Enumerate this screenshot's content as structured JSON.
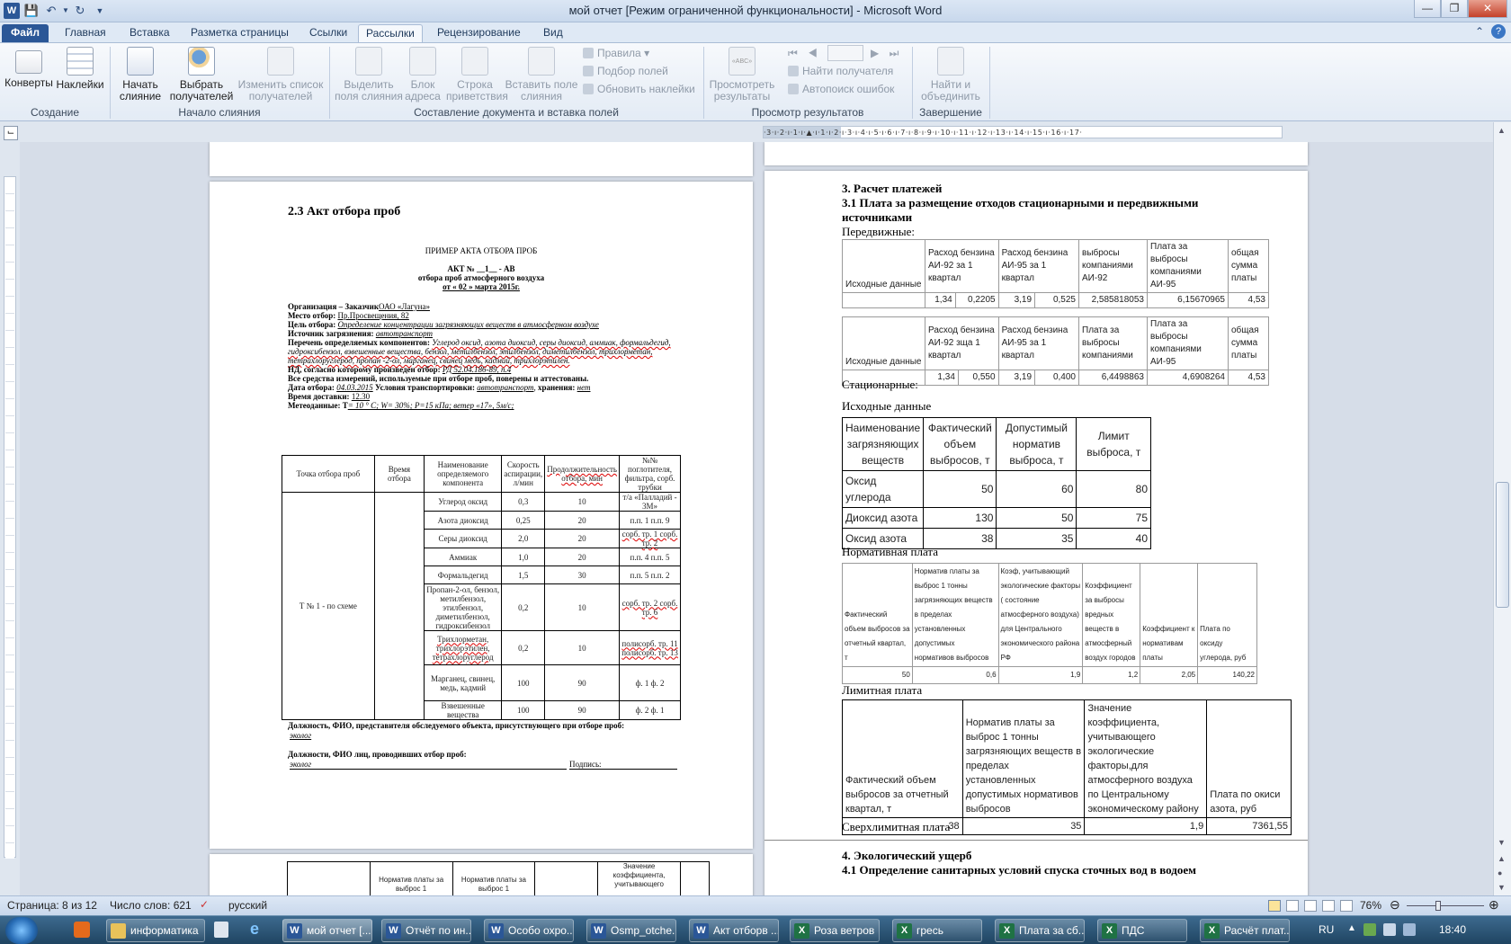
{
  "window": {
    "title": "мой отчет [Режим ограниченной функциональности]  -  Microsoft Word"
  },
  "menu": {
    "file": "Файл",
    "tabs": [
      "Главная",
      "Вставка",
      "Разметка страницы",
      "Ссылки",
      "Рассылки",
      "Рецензирование",
      "Вид"
    ]
  },
  "ribbon": {
    "create": {
      "envelopes": "Конверты",
      "labels": "Наклейки",
      "group": "Создание"
    },
    "start": {
      "start_merge": "Начать слияние",
      "select_recipients": "Выбрать получателей",
      "edit_list": "Изменить список получателей",
      "group": "Начало слияния"
    },
    "write": {
      "highlight": "Выделить поля слияния",
      "address": "Блок адреса",
      "greeting": "Строка приветствия",
      "insert_field": "Вставить поле слияния",
      "rules": "Правила",
      "match": "Подбор полей",
      "update": "Обновить наклейки",
      "group": "Составление документа и вставка полей"
    },
    "preview": {
      "view_results": "Просмотреть результаты",
      "find": "Найти получателя",
      "check": "Автопоиск ошибок",
      "group": "Просмотр результатов"
    },
    "finish": {
      "finish_merge": "Найти и объединить",
      "group": "Завершение"
    }
  },
  "page1": {
    "heading": "2.3 Акт отбора проб",
    "example": "ПРИМЕР АКТА ОТБОРА ПРОБ",
    "act_no": "АКТ № __1__ - АВ",
    "act_sub": "отбора проб атмосферного воздуха",
    "act_date": "от « 02 »  марта  2015г.",
    "fields": [
      {
        "label": "Организация – Заказчик",
        "value": "ОАО «Лагуна»"
      },
      {
        "label": "Место отбор:",
        "value": "Пр.Просвещения, 82"
      },
      {
        "label": "Цель отбора:",
        "value": "Определение концентрации загрязняющих веществ в атмосферном воздухе"
      },
      {
        "label": "Источник загрязнения:",
        "value": "автотранспорт"
      },
      {
        "label": "Перечень определяемых компонентов:",
        "value": "Углерод оксид, азота диоксид, серы диоксид, аммиак, формальдегид, гидроксибензол, взвешенные вещества, бензол, метилбензол, этилбензол, диметилбензол, трихлорметан, тетрахлоруглерод, пропан -2-ол, марганец, свинец медь, кадмий, трихлорэтилен."
      },
      {
        "label": "НД, согласно которому произведен отбор:",
        "value": "РД 52.04.186-89, п.4"
      },
      {
        "label": "Все средства измерений, используемые при отборе проб, поверены и аттестованы.",
        "value": ""
      },
      {
        "label": "Дата отбора:",
        "value": "04.03.2015"
      },
      {
        "label": "Условия транспортировки:",
        "value": "автотранспорт"
      },
      {
        "label": "хранения:",
        "value": "нет"
      },
      {
        "label": "Время доставки:",
        "value": "12.30"
      },
      {
        "label": "Метеоданные: T",
        "value": "= 10 ° С;  W= 30%;  P=15 кПа;  ветер «17»,   5м/с;"
      }
    ],
    "table_headers": [
      "Точка отбора проб",
      "Время отбора",
      "Наименование определяемого компонента",
      "Скорость аспирации, л/мин",
      "Продолжительность отбора, мин",
      "№№ поглотителя, фильтра, сорб. трубки"
    ],
    "point": "Т № 1 - по схеме",
    "rows": [
      [
        "Углерод оксид",
        "0,3",
        "10",
        "т/а «Палладий - 3М»"
      ],
      [
        "Азота диоксид",
        "0,25",
        "20",
        "п.п. 1 п.п. 9"
      ],
      [
        "Серы диоксид",
        "2,0",
        "20",
        "сорб. тр. 1 сорб. тр. 2"
      ],
      [
        "Аммиак",
        "1,0",
        "20",
        "п.п. 4 п.п. 5"
      ],
      [
        "Формальдегид",
        "1,5",
        "30",
        "п.п. 5 п.п. 2"
      ],
      [
        "Пропан-2-ол, бензол, метилбензол, этилбензол, диметилбензол, гидроксибензол",
        "0,2",
        "10",
        "сорб. тр. 2 сорб. тр. 6"
      ],
      [
        "Трихлорметан, трихлорэтилен, тетрахлоруглерод",
        "0,2",
        "10",
        "полисорб. тр. 11 полисорб. тр. 13"
      ],
      [
        "Марганец, свинец, медь, кадмий",
        "100",
        "90",
        "ф. 1 ф. 2"
      ],
      [
        "Взвешенные вещества",
        "100",
        "90",
        "ф. 2 ф. 1"
      ]
    ],
    "sign1": "Должность, ФИО, представителя обследуемого объекта, присутствующего  при отборе проб:",
    "sign1_val": "эколог",
    "sign2": "Должности, ФИО лиц, проводивших отбор проб:",
    "sign2_val": "эколог",
    "sign2_label": "Подпись:",
    "next_headers": [
      "Норматив платы за выброс 1",
      "Норматив платы за выброс 1",
      "Значение коэффициента, учитывающего"
    ]
  },
  "page2": {
    "h1": "3. Расчет платежей",
    "h2": "3.1 Плата за размещение отходов стационарными и передвижными источниками",
    "mobile": "Передвижные:",
    "t1_headers": [
      "Исходные данные",
      "Расход бензина АИ-92 за 1 квартал",
      "Расход бензина АИ-95 за 1 квартал",
      "выбросы компаниями АИ-92",
      "Плата за выбросы компаниями АИ-95",
      "общая сумма платы"
    ],
    "t1_row": [
      "1,34",
      "0,2205",
      "3,19",
      "0,525",
      "2,585818053",
      "6,15670965",
      "4,53"
    ],
    "t2_headers": [
      "Исходные данные",
      "Расход бензина АИ-92 зща 1 квартал",
      "Расход бензина АИ-95 за 1 квартал",
      "Плата за выбросы компаниями",
      "Плата за выбросы компаниями АИ-95",
      "общая сумма платы"
    ],
    "t2_row": [
      "1,34",
      "0,550",
      "3,19",
      "0,400",
      "6,4498863",
      "4,6908264",
      "4,53"
    ],
    "stationary": "Стационарные:",
    "source": "Исходные данные",
    "t3_headers": [
      "Наименование загрязняющих веществ",
      "Фактический объем выбросов, т",
      "Допустимый норматив выброса, т",
      "Лимит выброса, т"
    ],
    "t3_rows": [
      [
        "Оксид углерода",
        "50",
        "60",
        "80"
      ],
      [
        "Диоксид азота",
        "130",
        "50",
        "75"
      ],
      [
        "Оксид азота",
        "38",
        "35",
        "40"
      ]
    ],
    "normative": "Нормативная плата",
    "t4_headers": [
      "Фактический объем выбросов за отчетный квартал, т",
      "Норматив платы за выброс 1 тонны загрязняющих веществ в пределах установленных допустимых нормативов выбросов",
      "Коэф, учитывающий экологические факторы ( состояние атмосферного воздуха) для Центрального экономического района РФ",
      "Коэффициент за выбросы вредных веществ в атмосферный воздух городов",
      "Коэффициент к нормативам платы",
      "Плата по оксиду углерода, руб"
    ],
    "t4_row": [
      "50",
      "0,6",
      "1,9",
      "1,2",
      "2,05",
      "140,22"
    ],
    "limit": "Лимитная плата",
    "t5_headers": [
      "Фактический объем выбросов за отчетный квартал, т",
      "Норматив платы за выброс 1 тонны загрязняющих веществ в пределах установленных допустимых нормативов выбросов",
      "Значение коэффициента, учитывающего экологические факторы,для атмосферного воздуха по Центральному экономическому району",
      "Плата по окиси азота, руб"
    ],
    "t5_row": [
      "38",
      "35",
      "1,9",
      "7361,55"
    ],
    "over": "Сверхлимитная плата",
    "h3": "4. Экологический ущерб",
    "h4": "4.1  Определение санитарных условий спуска сточных вод в водоем"
  },
  "status": {
    "page": "Страница: 8 из 12",
    "words": "Число слов: 621",
    "lang": "русский",
    "zoom": "76%"
  },
  "taskbar": {
    "items": [
      "информатика",
      "мой отчет [...",
      "Отчёт по ин...",
      "Особо охро...",
      "Osmp_otche...",
      "Акт отборв ...",
      "Роза ветров",
      "гресь",
      "Плата за сб...",
      "ПДС",
      "Расчёт плат..."
    ],
    "lang": "RU",
    "clock": "18:40"
  }
}
